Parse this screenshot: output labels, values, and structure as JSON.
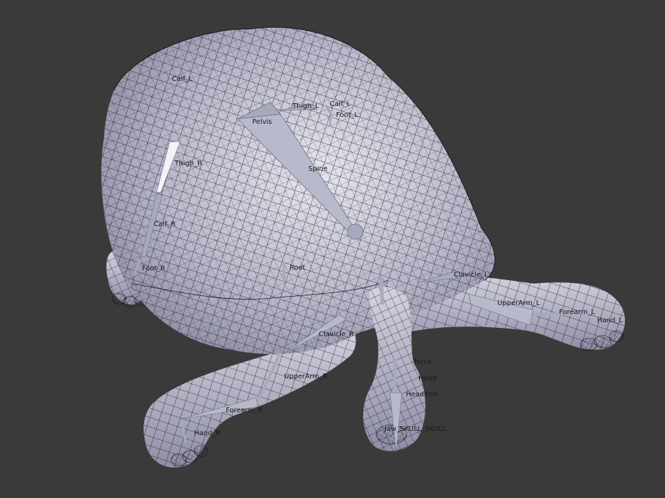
{
  "viewport": {
    "background": "#3a3a3a",
    "mesh_fill": "#b4b3c6",
    "wire_color": "#15151c",
    "bone_color": "#a9a9bd"
  },
  "bones": {
    "pelvis": "Pelvis",
    "spine": "Spine",
    "root": "Root",
    "thigh_l": "Thigh_L",
    "calf_l": "Calf_L",
    "foot_l": "Foot_L",
    "thigh_r": "Thigh_R",
    "calf_r": "Calf_R",
    "foot_r": "Foot_R",
    "calf_top": "Calf_L",
    "clavicle_l": "Clavicle_L",
    "upper_arm_l": "UpperArm_L",
    "forearm_l": "Forearm_L",
    "hand_l": "Hand_L",
    "clavicle_r": "Clavicle_R",
    "upper_arm_r": "UpperArm_R",
    "forearm_r": "Forearm_R",
    "hand_r": "Hand_R",
    "neck": "Neck",
    "head": "Head",
    "head_end": "HeadEnd",
    "jaw": "Jaw_SKULL_SKULL"
  }
}
